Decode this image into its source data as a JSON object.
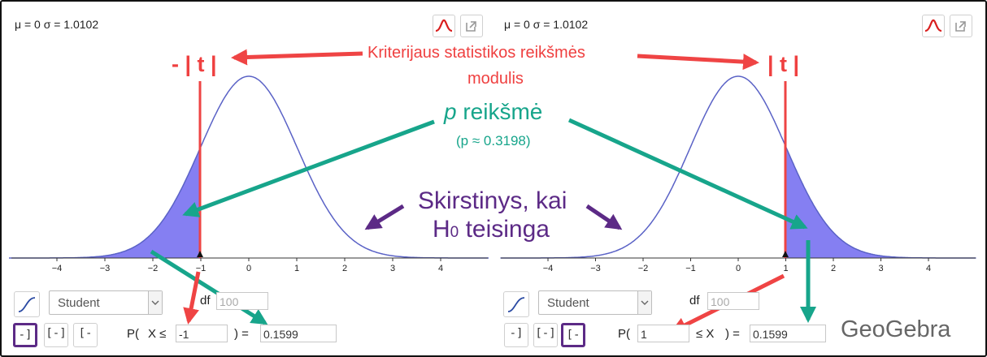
{
  "left_panel": {
    "params": "μ = 0 σ = 1.0102",
    "distribution": "Student",
    "df_label": "df",
    "df_value": "100",
    "prob_prefix": "P(",
    "prob_mid": "X ≤",
    "prob_input": "-1",
    "prob_suffix": ") =",
    "prob_result": "0.1599",
    "selected_mode": "left-sided"
  },
  "right_panel": {
    "params": "μ = 0 σ = 1.0102",
    "distribution": "Student",
    "df_label": "df",
    "df_value": "100",
    "prob_prefix": "P(",
    "prob_input": "1",
    "prob_mid": "≤ X",
    "prob_suffix": ") =",
    "prob_result": "0.1599",
    "selected_mode": "right-sided"
  },
  "axis_ticks": [
    "−4",
    "−3",
    "−2",
    "−1",
    "0",
    "1",
    "2",
    "3",
    "4"
  ],
  "annotations": {
    "criterion_line1": "Kriterijaus statistikos reikšmės",
    "criterion_line2": "modulis",
    "neg_t": "- | t |",
    "pos_t": "| t |",
    "p_letter": "p",
    "p_word": " reikšmė",
    "p_approx": "(p ≈ 0.3198)",
    "dist_line1": "Skirstinys, kai",
    "dist_line2_H": "H",
    "dist_line2_sub": "0",
    "dist_line2_rest": " teisinga"
  },
  "logo": "GeoGebra",
  "colors": {
    "curve": "#5a62c6",
    "shade": "#7068f0",
    "critical_line": "#ee4444",
    "teal": "#17a58b",
    "purple": "#5c2a86"
  }
}
